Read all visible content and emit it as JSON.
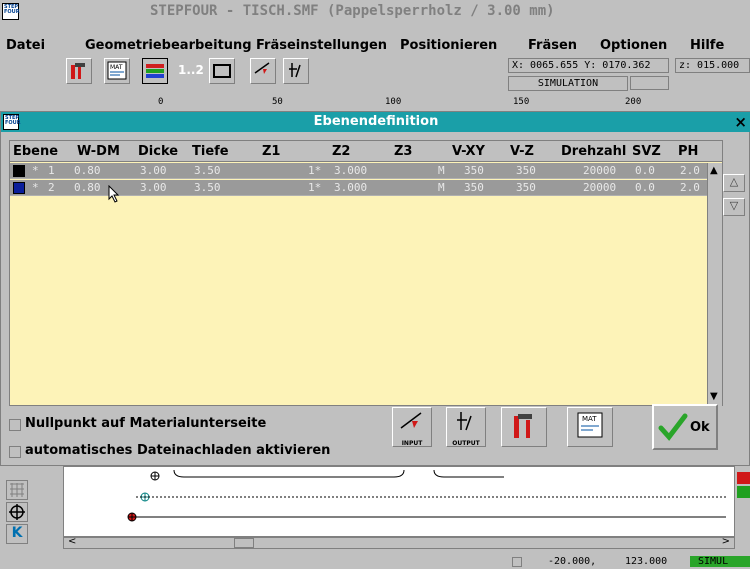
{
  "app": {
    "logo": "STEP FOUR",
    "title": "STEPFOUR - TISCH.SMF (Pappelsperrholz / 3.00 mm)"
  },
  "menu": [
    {
      "label": "Datei"
    },
    {
      "label": "Geometriebearbeitung"
    },
    {
      "label": "Fräseinstellungen"
    },
    {
      "label": "Positionieren"
    },
    {
      "label": "Fräsen"
    },
    {
      "label": "Optionen"
    },
    {
      "label": "Hilfe"
    }
  ],
  "toolbar": {
    "coords": "X: 0065.655 Y: 0170.362",
    "z": "z: 015.000",
    "mode": "SIMULATION",
    "input_label": "INPUT",
    "output_label": "OUTPUT",
    "mat_label": "MAT",
    "seq_label": "1..2"
  },
  "ruler": {
    "ticks": [
      "0",
      "50",
      "100",
      "150",
      "200"
    ]
  },
  "dialog": {
    "title": "Ebenendefinition",
    "logo": "STEP FOUR",
    "columns": [
      "Ebene",
      "W-DM",
      "Dicke",
      "Tiefe",
      "Z1",
      "Z2",
      "Z3",
      "V-XY",
      "V-Z",
      "Drehzahl",
      "SVZ",
      "PH"
    ],
    "rows": [
      {
        "color": "#000000",
        "star": "*",
        "nr": "1",
        "wdm": "0.80",
        "dicke": "3.00",
        "tiefe": "3.50",
        "z1": "1*",
        "z2": "3.000",
        "z3": "M",
        "vxy": "350",
        "vz": "350",
        "drehzahl": "20000",
        "svz": "0.0",
        "ph": "2.0"
      },
      {
        "color": "#0a1e9a",
        "star": "*",
        "nr": "2",
        "wdm": "0.80",
        "dicke": "3.00",
        "tiefe": "3.50",
        "z1": "1*",
        "z2": "3.000",
        "z3": "M",
        "vxy": "350",
        "vz": "350",
        "drehzahl": "20000",
        "svz": "0.0",
        "ph": "2.0"
      }
    ],
    "nullpunkt_label": "Nullpunkt auf Materialunterseite",
    "nachladen_label": "automatisches Dateinachladen aktivieren",
    "ok_label": "Ok",
    "input_label": "INPUT",
    "output_label": "OUTPUT",
    "mat_label": "MAT"
  },
  "status": {
    "coords": "-20.000,",
    "coords2": "123.000",
    "mode": "SIMUL"
  },
  "colors": {
    "title_bar": "#1a9fa8",
    "grid_bg": "#fdf3b8",
    "row_bg": "#9a9a9a",
    "ok_green": "#2aa52a",
    "hammer_red": "#d01818"
  }
}
